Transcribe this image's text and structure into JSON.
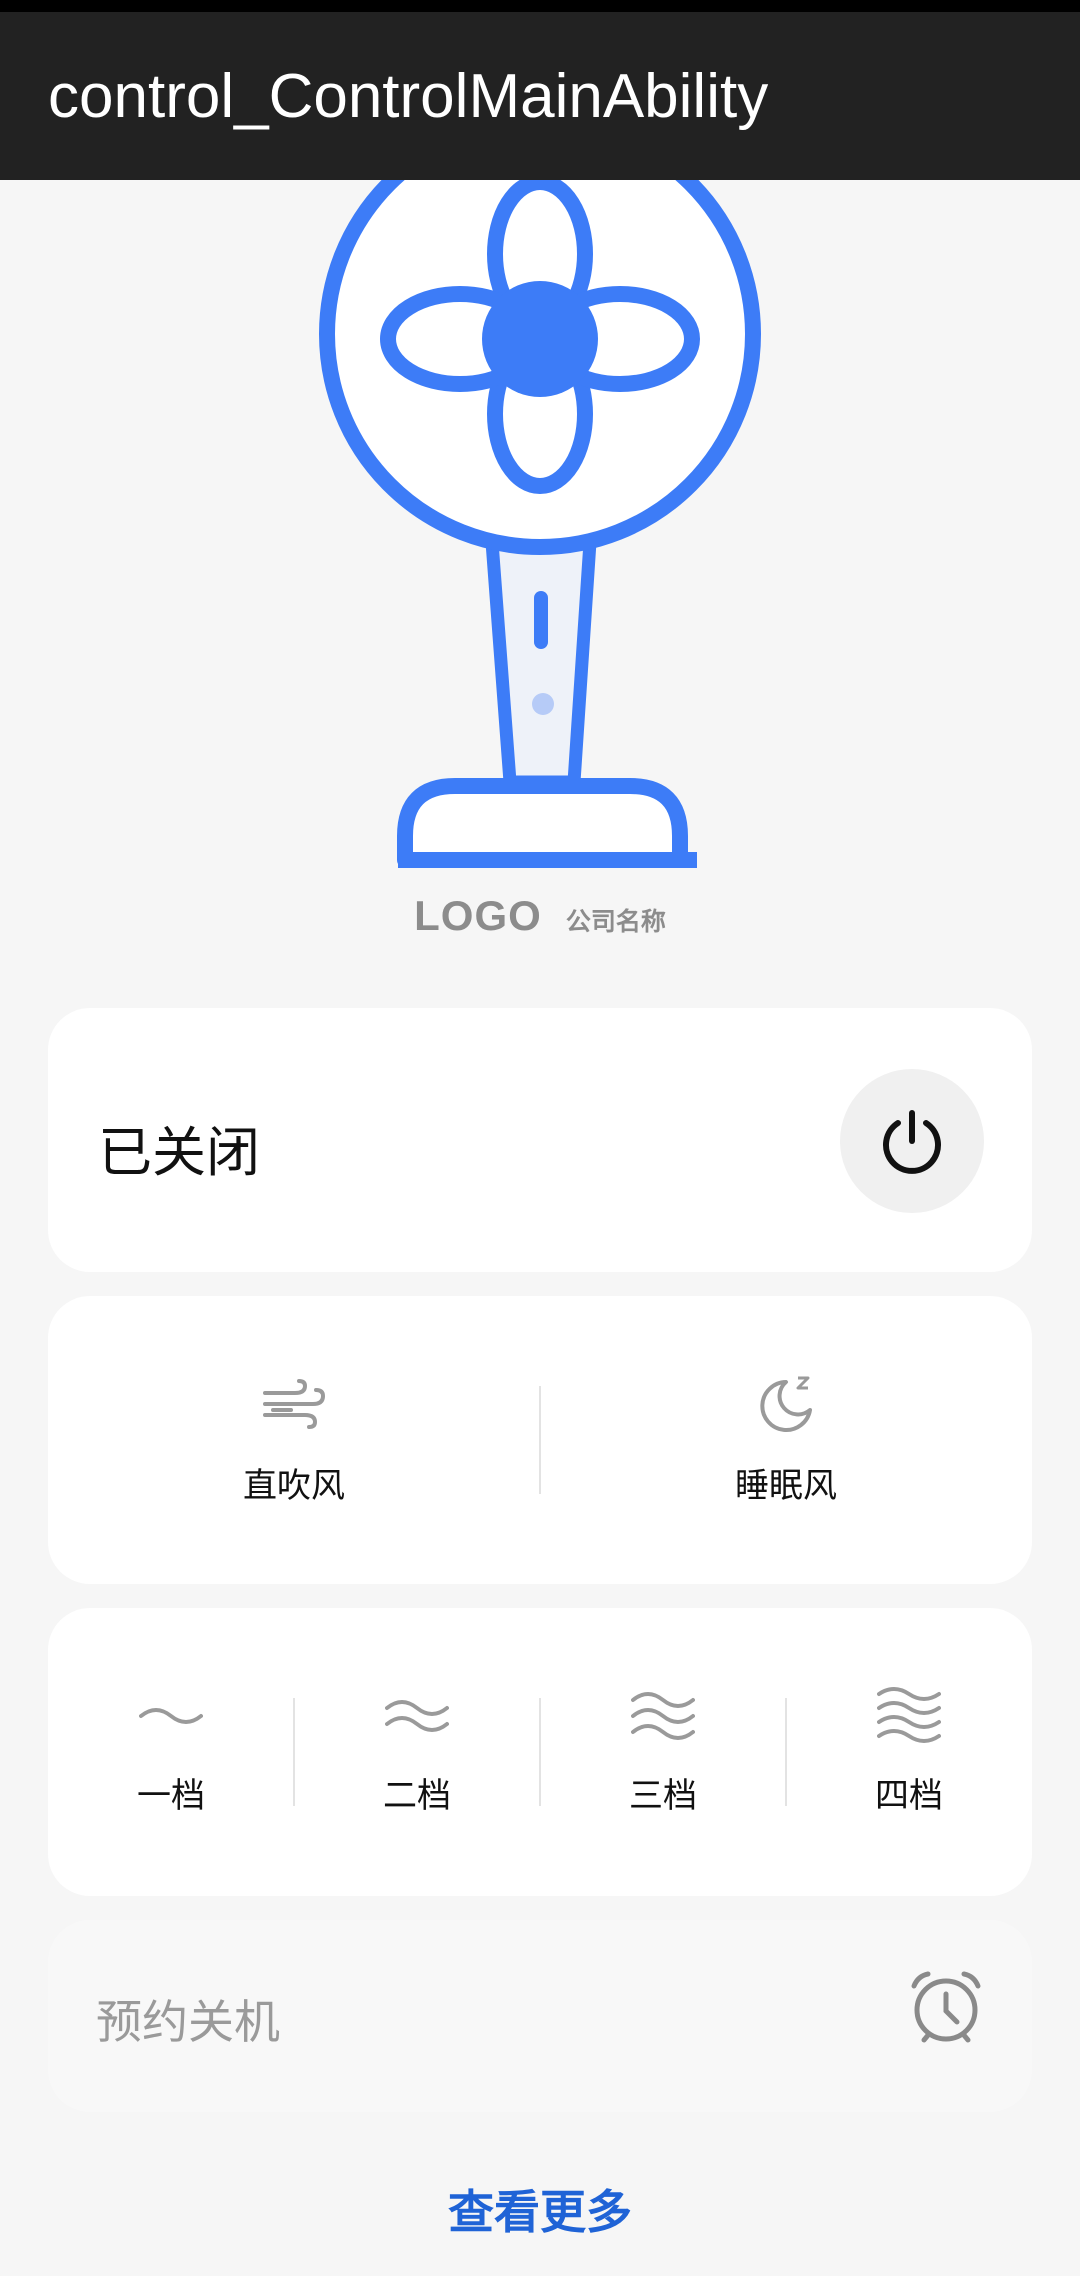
{
  "app_bar": {
    "title": "control_ControlMainAbility"
  },
  "brand": {
    "logo": "LOGO",
    "company": "公司名称"
  },
  "power": {
    "status": "已关闭",
    "icon": "power-icon"
  },
  "modes": [
    {
      "label": "直吹风",
      "icon": "wind-icon"
    },
    {
      "label": "睡眠风",
      "icon": "sleep-moon-icon"
    }
  ],
  "speeds": [
    {
      "label": "一档",
      "icon": "wave-1-icon"
    },
    {
      "label": "二档",
      "icon": "wave-2-icon"
    },
    {
      "label": "三档",
      "icon": "wave-3-icon"
    },
    {
      "label": "四档",
      "icon": "wave-4-icon"
    }
  ],
  "timer": {
    "label": "预约关机",
    "icon": "alarm-clock-icon"
  },
  "more": {
    "label": "查看更多"
  },
  "colors": {
    "accent": "#3d7cf7",
    "link": "#1f63d6",
    "app_bar": "#222222"
  }
}
